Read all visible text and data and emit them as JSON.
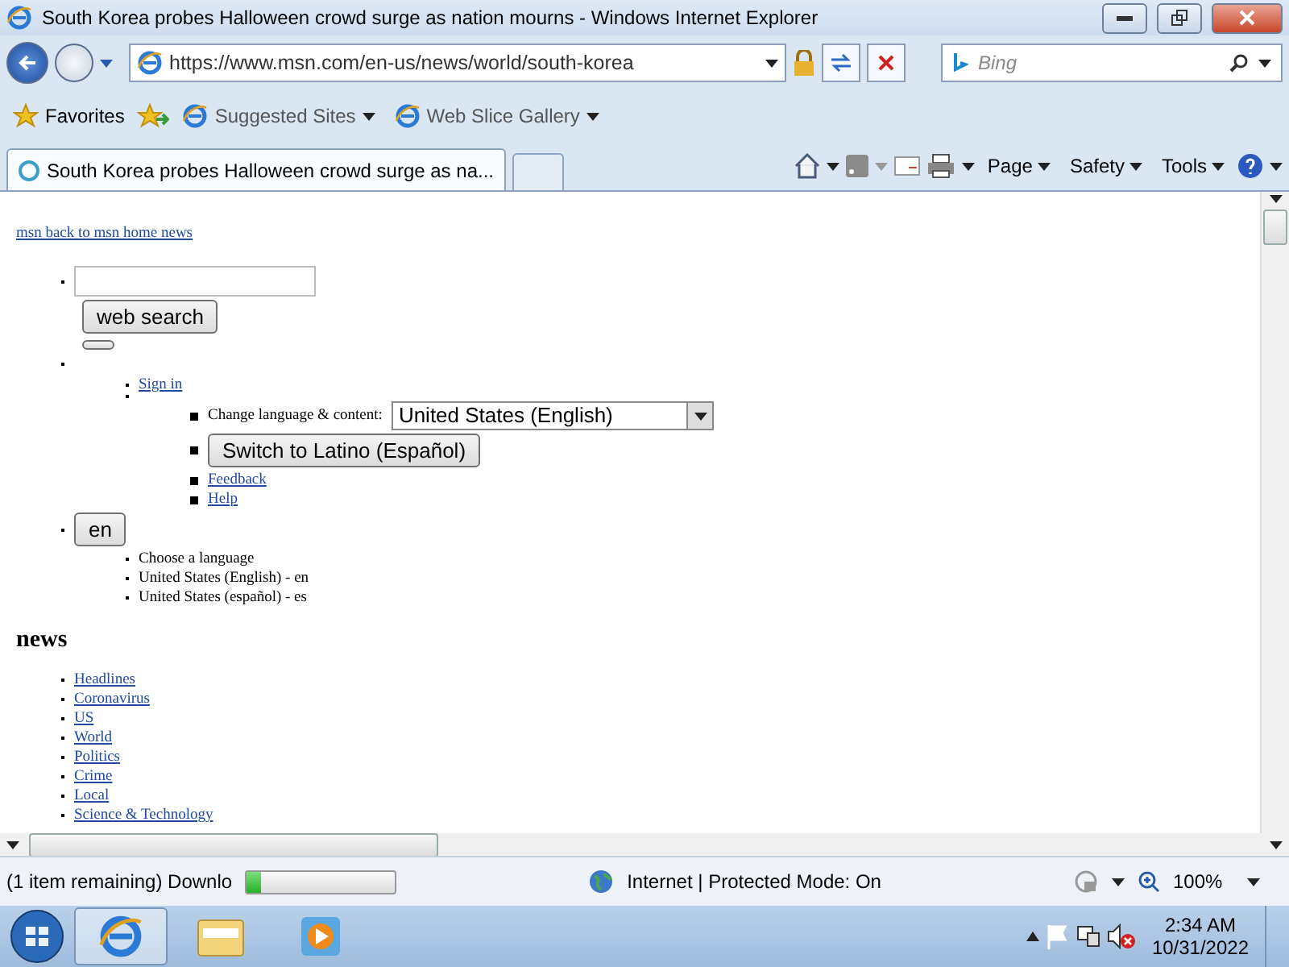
{
  "window": {
    "title": "South Korea probes Halloween crowd surge as nation mourns - Windows Internet Explorer"
  },
  "address_bar": {
    "url": "https://www.msn.com/en-us/news/world/south-korea",
    "search_placeholder": "Bing"
  },
  "favorites_bar": {
    "favorites": "Favorites",
    "links": [
      "Suggested Sites",
      "Web Slice Gallery"
    ]
  },
  "tabs": [
    {
      "label": "South Korea probes Halloween crowd surge as na...",
      "selected": true
    }
  ],
  "command_bar": {
    "menus": [
      "Page",
      "Safety",
      "Tools"
    ]
  },
  "page": {
    "back_link": "msn back to msn home news",
    "search_button": "web search",
    "sign_in": "Sign in",
    "language_label": "Change language & content:",
    "language_select": "United States (English)",
    "switch_button": "Switch to Latino (Español)",
    "links": [
      "Feedback",
      "Help"
    ],
    "language_button": "en",
    "language_list": [
      "Choose a language",
      "United States (English) - en",
      "United States (español) - es"
    ],
    "news_heading": "news",
    "news_links": [
      "Headlines",
      "Coronavirus",
      "US",
      "World",
      "Politics",
      "Crime",
      "Local",
      "Science & Technology"
    ]
  },
  "status_bar": {
    "text": "(1 item remaining) Downlo",
    "progress": {
      "level": 0.1
    },
    "zone": "Internet | Protected Mode: On",
    "zoom": "100%"
  },
  "taskbar": {
    "apps": [
      {
        "kind": "ie",
        "selected": true
      },
      {
        "kind": "explorer",
        "selected": false
      },
      {
        "kind": "media",
        "selected": false
      }
    ],
    "time": "2:34 AM",
    "date": "10/31/2022"
  }
}
